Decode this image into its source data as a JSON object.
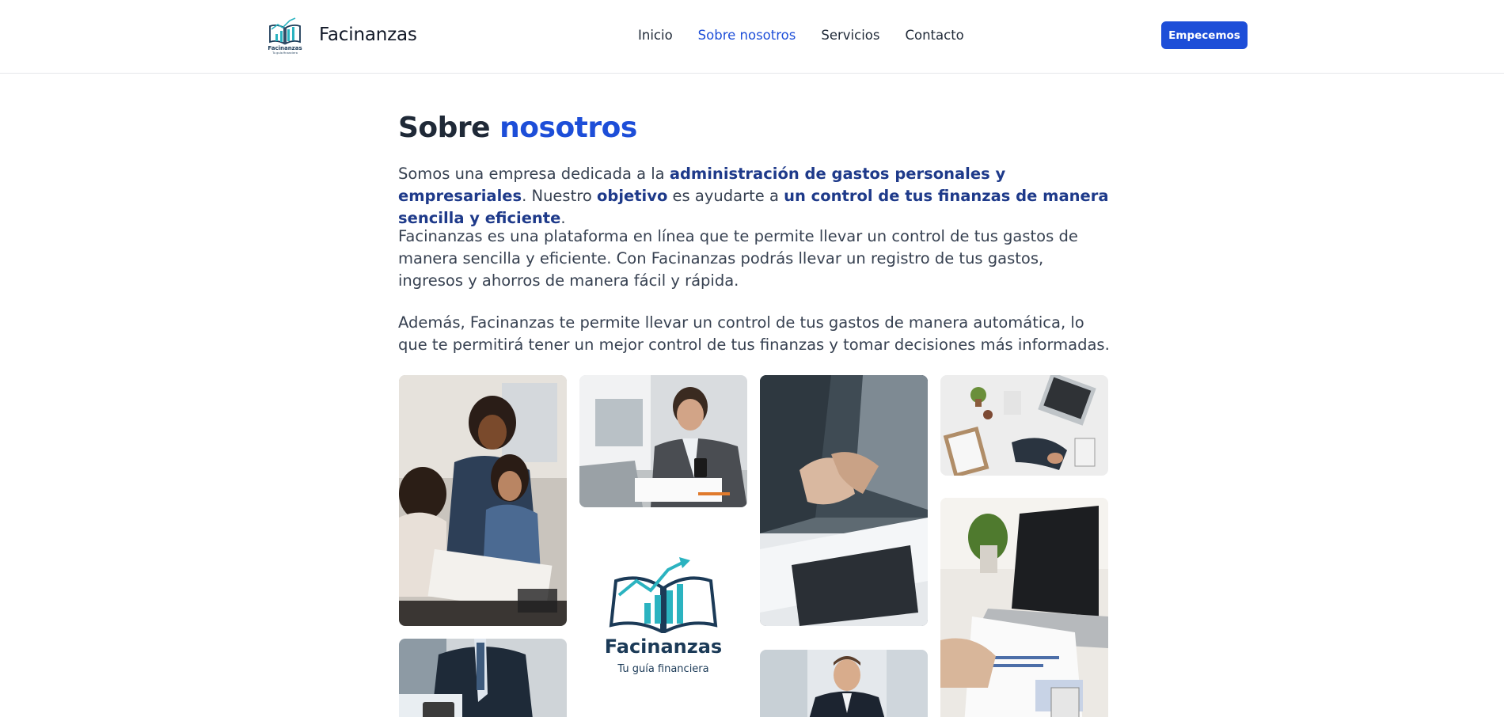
{
  "header": {
    "brand": "Facinanzas",
    "logo_text": "Facinanzas",
    "logo_tagline": "Tu guía financiera",
    "nav": [
      {
        "label": "Inicio",
        "active": false
      },
      {
        "label": "Sobre nosotros",
        "active": true
      },
      {
        "label": "Servicios",
        "active": false
      },
      {
        "label": "Contacto",
        "active": false
      }
    ],
    "cta_label": "Empecemos"
  },
  "section": {
    "title_plain": "Sobre",
    "title_accent": "nosotros",
    "paragraph1": {
      "t1": "Somos una empresa dedicada a la ",
      "h1": "administración de gastos personales y empresariales",
      "t2": ". Nuestro ",
      "h2": "objetivo",
      "t3": " es ayudarte a ",
      "h3": "un control de tus finanzas de manera sencilla y eficiente",
      "t4": "."
    },
    "paragraph2": "Facinanzas es una plataforma en línea que te permite llevar un control de tus gastos de manera sencilla y eficiente. Con Facinanzas podrás llevar un registro de tus gastos, ingresos y ahorros de manera fácil y rápida.",
    "paragraph3": "Además, Facinanzas te permite llevar un control de tus gastos de manera automática, lo que te permitirá tener un mejor control de tus finanzas y tomar decisiones más informadas."
  },
  "gallery": {
    "logo_name": "Facinanzas",
    "logo_tagline": "Tu guía financiera"
  },
  "colors": {
    "accent": "#1d4ed8",
    "highlight": "#1e3a8a",
    "logo_dark": "#1b3a57",
    "logo_teal": "#2bb3c0"
  }
}
